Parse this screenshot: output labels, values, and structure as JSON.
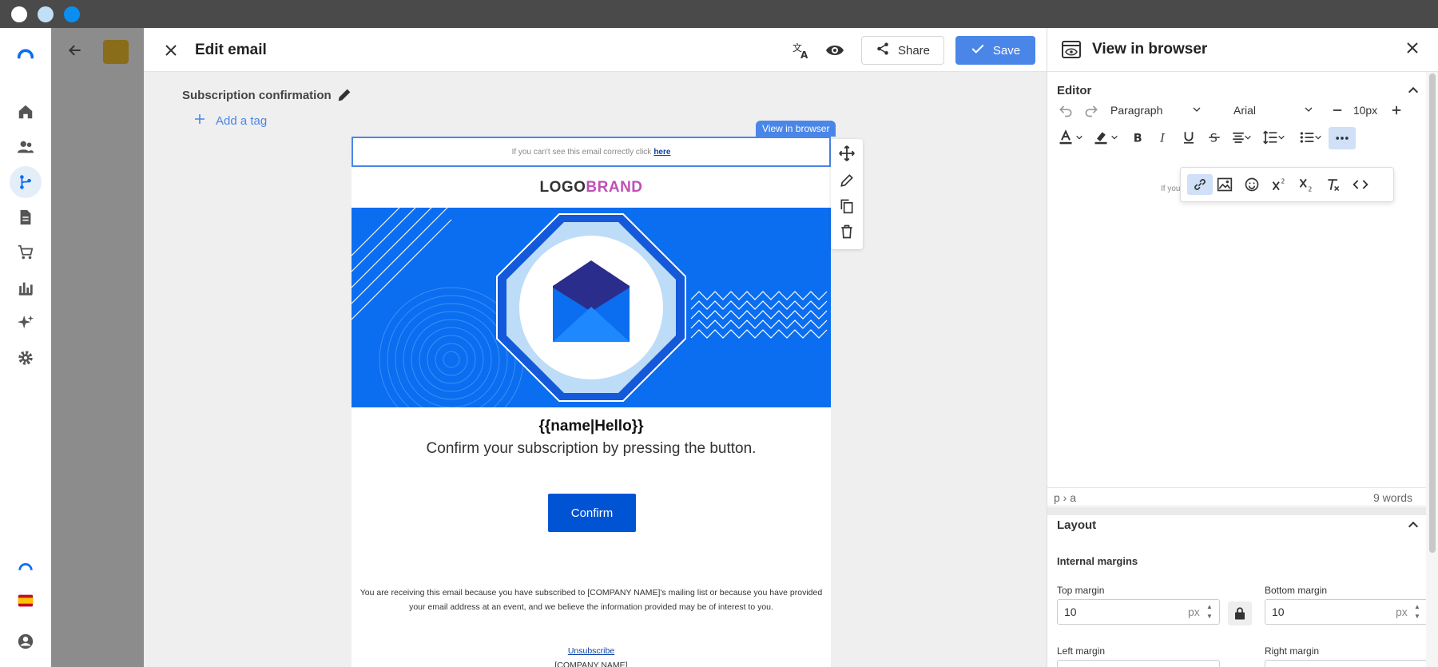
{
  "editor": {
    "title": "Edit email",
    "share_label": "Share",
    "save_label": "Save",
    "subject": "Subscription confirmation",
    "add_tag_label": "Add a tag",
    "view_in_browser_tag": "View in browser"
  },
  "email": {
    "preheader_text": "If you can't see this email correctly click",
    "preheader_link": "here",
    "logo_part1": "LOGO",
    "logo_part2": "BRAND",
    "greeting": "{{name|Hello}}",
    "confirm_text": "Confirm your subscription by pressing the button.",
    "confirm_button": "Confirm",
    "footer_text": "You are receiving this email because you have subscribed to [COMPANY NAME]'s mailing list or because you have provided your email address at an event, and we believe the information provided may be of interest to you.",
    "unsubscribe": "Unsubscribe",
    "company": "[COMPANY NAME]"
  },
  "panel": {
    "title": "View in browser",
    "editor_section": "Editor",
    "paragraph_select": "Paragraph",
    "font_select": "Arial",
    "font_size": "10px",
    "preview_snippet": "If you",
    "status_path": "p › a",
    "word_count": "9 words",
    "layout_section": "Layout",
    "internal_margins": "Internal margins",
    "top_margin_label": "Top margin",
    "top_margin_value": "10",
    "bottom_margin_label": "Bottom margin",
    "bottom_margin_value": "10",
    "left_margin_label": "Left margin",
    "right_margin_label": "Right margin",
    "unit": "px"
  },
  "colors": {
    "accent": "#4a86e8",
    "hero_blue": "#0b6ef0",
    "button_blue": "#0054d4",
    "brand_pink": "#c04fb8"
  }
}
